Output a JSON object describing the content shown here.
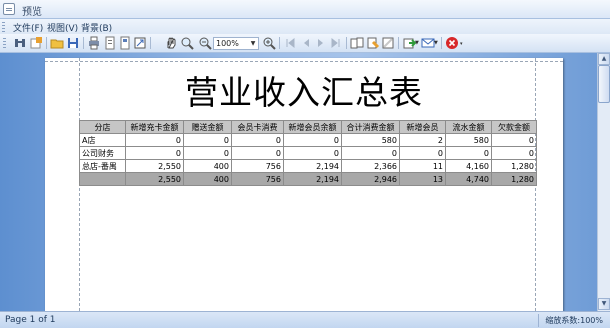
{
  "window": {
    "title": "预览"
  },
  "menu": {
    "items": [
      "文件(F)",
      "视图(V)",
      "背景(B)"
    ]
  },
  "toolbar": {
    "zoom_value": "100%"
  },
  "report": {
    "title": "营业收入汇总表",
    "columns": [
      "分店",
      "新增充卡金额",
      "赠送金额",
      "会员卡消费",
      "新增会员余额",
      "合计消费金额",
      "新增会员",
      "流水金额",
      "欠款金额"
    ],
    "rows": [
      [
        "A店",
        "0",
        "0",
        "0",
        "0",
        "580",
        "2",
        "580",
        "0"
      ],
      [
        "公司财务",
        "0",
        "0",
        "0",
        "0",
        "0",
        "0",
        "0",
        "0"
      ],
      [
        "总店-番禺",
        "2,550",
        "400",
        "756",
        "2,194",
        "2,366",
        "11",
        "4,160",
        "1,280"
      ]
    ],
    "total": [
      "",
      "2,550",
      "400",
      "756",
      "2,194",
      "2,946",
      "13",
      "4,740",
      "1,280"
    ]
  },
  "status": {
    "page_info": "Page 1 of 1",
    "zoom_info": "缩放系数:100%"
  },
  "colors": {
    "frame_blue": "#c5d9f1",
    "header_gray": "#c6c6c6",
    "total_gray": "#a8a8a8"
  }
}
